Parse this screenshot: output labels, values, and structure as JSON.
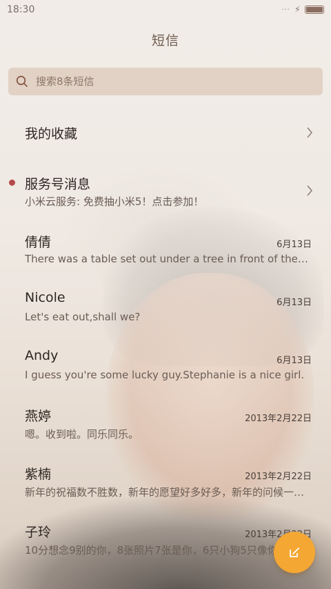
{
  "status_bar": {
    "time": "18:30",
    "signal_dots": "···",
    "charging_icon": "⚡"
  },
  "header": {
    "title": "短信"
  },
  "search": {
    "placeholder": "搜索8条短信"
  },
  "favorites": {
    "label": "我的收藏"
  },
  "service": {
    "name": "服务号消息",
    "preview": "小米云服务: 免费抽小米5！点击参加！"
  },
  "conversations": [
    {
      "name": "倩倩",
      "date": "6月13日",
      "preview": "There was a table set out under a tree in front of the house"
    },
    {
      "name": "Nicole",
      "date": "6月13日",
      "preview": "Let's eat out,shall we?"
    },
    {
      "name": "Andy",
      "date": "6月13日",
      "preview": "I guess you're some lucky guy.Stephanie is a nice girl."
    },
    {
      "name": "燕婷",
      "date": "2013年2月22日",
      "preview": "嗯。收到啦。同乐同乐。"
    },
    {
      "name": "紫楠",
      "date": "2013年2月22日",
      "preview": "新年的祝福数不胜数，新年的愿望好多好多，新年的问候一句就够"
    },
    {
      "name": "子玲",
      "date": "2013年2月22日",
      "preview": "10分想念9别的你，8张照片7张是你，6只小狗5只像你"
    }
  ],
  "colors": {
    "accent": "#f5a733",
    "unread": "#b44a4a",
    "title": "#6d5a4f"
  },
  "icons": {
    "search": "search-icon",
    "compose": "compose-icon",
    "chevron": "chevron-right-icon"
  }
}
